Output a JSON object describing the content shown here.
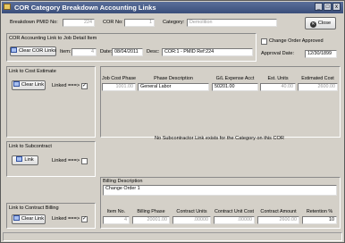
{
  "window": {
    "title": "COR Category Breakdown Accounting Links",
    "minimize": "_",
    "maximize": "□",
    "close": "x"
  },
  "header": {
    "pmid_label": "Breakdown PMID No:",
    "pmid_value": "224",
    "cor_label": "COR No:",
    "cor_value": "1",
    "category_label": "Category:",
    "category_value": "Demolition",
    "close_label": "Close"
  },
  "job_detail": {
    "group_label": "COR Accounting Link to Job Detail Item",
    "clear_label": "Clear COR Links",
    "item_label": "Item:",
    "item_value": "4",
    "date_label": "Date:",
    "date_value": "08/04/2011",
    "desc_label": "Desc:",
    "desc_value": "COR:1 - PMID Ref:224"
  },
  "approval": {
    "checkbox_label": "Change Order Approved",
    "date_label": "Approval Date:",
    "date_value": "12/30/1899"
  },
  "cost_estimate": {
    "group_label": "Link to Cost Estimate",
    "clear_label": "Clear Link",
    "linked_label": "Linked ===>",
    "linked_checked": true,
    "columns": [
      "Job Cost Phase",
      "Phase Description",
      "G/L Expense Acct",
      "Est. Units",
      "Estimated Cost"
    ],
    "row": [
      "1001.00",
      "General Labor",
      "50201.00",
      "40.00",
      "2600.00"
    ]
  },
  "subcontractor": {
    "group_label": "Link to Subcontract",
    "link_label": "Link",
    "linked_label": "Linked ===>",
    "linked_checked": false,
    "message": "No Subcontractor Link exists for the Category on this COR"
  },
  "billing": {
    "description_label": "Billing Description",
    "description_value": "Change Order 1",
    "group_label": "Link to Contract Billing",
    "clear_label": "Clear Link",
    "linked_label": "Linked ===>",
    "linked_checked": true,
    "columns": [
      "Item No.",
      "Billing Phase",
      "Contract Units",
      "Contract Unit Cost",
      "Contract Amount",
      "Retention %"
    ],
    "row": [
      "4",
      "20001.00",
      ".00000",
      ".00000",
      "2600.00",
      "10"
    ]
  }
}
